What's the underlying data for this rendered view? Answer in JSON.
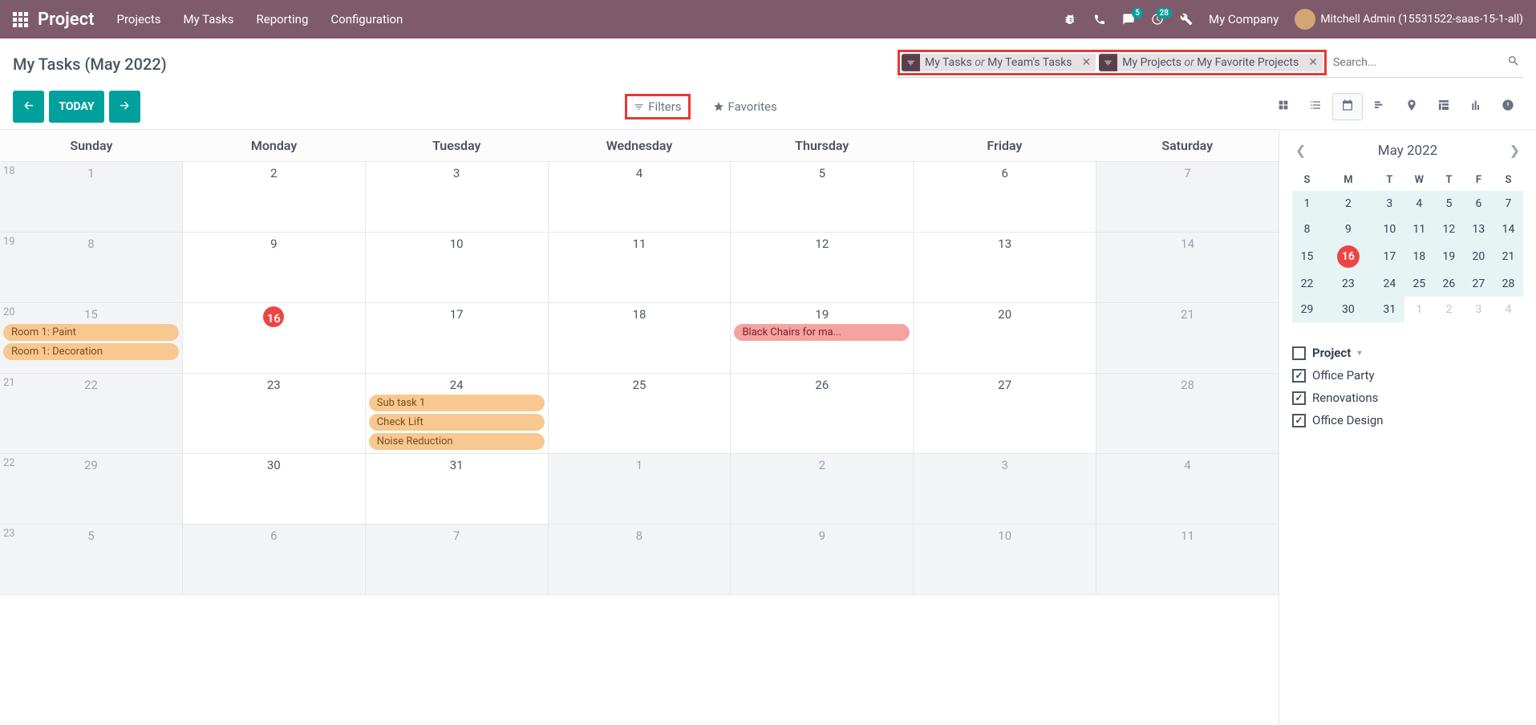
{
  "nav": {
    "brand": "Project",
    "links": [
      "Projects",
      "My Tasks",
      "Reporting",
      "Configuration"
    ],
    "messages_badge": "5",
    "activities_badge": "28",
    "company": "My Company",
    "user": "Mitchell Admin (15531522-saas-15-1-all)"
  },
  "cp": {
    "title": "My Tasks (May 2022)",
    "chip1_a": "My Tasks",
    "chip1_or": "or",
    "chip1_b": "My Team's Tasks",
    "chip2_a": "My Projects",
    "chip2_or": "or",
    "chip2_b": "My Favorite Projects",
    "search_placeholder": "Search...",
    "today": "TODAY",
    "filters": "Filters",
    "favorites": "Favorites"
  },
  "cal": {
    "days": [
      "Sunday",
      "Monday",
      "Tuesday",
      "Wednesday",
      "Thursday",
      "Friday",
      "Saturday"
    ],
    "weeks": [
      {
        "num": "18",
        "cells": [
          {
            "n": "1",
            "o": false
          },
          {
            "n": "2"
          },
          {
            "n": "3"
          },
          {
            "n": "4"
          },
          {
            "n": "5"
          },
          {
            "n": "6"
          },
          {
            "n": "7",
            "o": true
          }
        ]
      },
      {
        "num": "19",
        "cells": [
          {
            "n": "8",
            "o": false
          },
          {
            "n": "9"
          },
          {
            "n": "10"
          },
          {
            "n": "11"
          },
          {
            "n": "12"
          },
          {
            "n": "13"
          },
          {
            "n": "14",
            "o": true
          }
        ]
      },
      {
        "num": "20",
        "cells": [
          {
            "n": "15",
            "o": false,
            "ev": [
              {
                "t": "Room 1: Paint",
                "c": "orange"
              },
              {
                "t": "Room 1: Decoration",
                "c": "orange"
              }
            ]
          },
          {
            "n": "16",
            "today": true
          },
          {
            "n": "17"
          },
          {
            "n": "18"
          },
          {
            "n": "19",
            "ev": [
              {
                "t": "Black Chairs for ma...",
                "c": "pink"
              }
            ]
          },
          {
            "n": "20"
          },
          {
            "n": "21",
            "o": true
          }
        ]
      },
      {
        "num": "21",
        "cells": [
          {
            "n": "22",
            "o": false
          },
          {
            "n": "23"
          },
          {
            "n": "24",
            "ev": [
              {
                "t": "Sub task 1",
                "c": "orange"
              },
              {
                "t": "Check Lift",
                "c": "orange"
              },
              {
                "t": "Noise Reduction",
                "c": "orange"
              }
            ]
          },
          {
            "n": "25"
          },
          {
            "n": "26"
          },
          {
            "n": "27"
          },
          {
            "n": "28",
            "o": true
          }
        ]
      },
      {
        "num": "22",
        "cells": [
          {
            "n": "29",
            "o": false
          },
          {
            "n": "30"
          },
          {
            "n": "31"
          },
          {
            "n": "1",
            "o": true
          },
          {
            "n": "2",
            "o": true
          },
          {
            "n": "3",
            "o": true
          },
          {
            "n": "4",
            "o": true
          }
        ]
      },
      {
        "num": "23",
        "cells": [
          {
            "n": "5",
            "o": true
          },
          {
            "n": "6",
            "o": true
          },
          {
            "n": "7",
            "o": true
          },
          {
            "n": "8",
            "o": true
          },
          {
            "n": "9",
            "o": true
          },
          {
            "n": "10",
            "o": true
          },
          {
            "n": "11",
            "o": true
          }
        ]
      }
    ]
  },
  "mini": {
    "title": "May 2022",
    "dow": [
      "S",
      "M",
      "T",
      "W",
      "T",
      "F",
      "S"
    ],
    "rows": [
      [
        {
          "n": "1",
          "m": true
        },
        {
          "n": "2",
          "m": true
        },
        {
          "n": "3",
          "m": true
        },
        {
          "n": "4",
          "m": true
        },
        {
          "n": "5",
          "m": true
        },
        {
          "n": "6",
          "m": true
        },
        {
          "n": "7",
          "m": true
        }
      ],
      [
        {
          "n": "8",
          "m": true
        },
        {
          "n": "9",
          "m": true
        },
        {
          "n": "10",
          "m": true
        },
        {
          "n": "11",
          "m": true
        },
        {
          "n": "12",
          "m": true
        },
        {
          "n": "13",
          "m": true
        },
        {
          "n": "14",
          "m": true
        }
      ],
      [
        {
          "n": "15",
          "m": true
        },
        {
          "n": "16",
          "m": true,
          "today": true
        },
        {
          "n": "17",
          "m": true
        },
        {
          "n": "18",
          "m": true
        },
        {
          "n": "19",
          "m": true
        },
        {
          "n": "20",
          "m": true
        },
        {
          "n": "21",
          "m": true
        }
      ],
      [
        {
          "n": "22",
          "m": true
        },
        {
          "n": "23",
          "m": true
        },
        {
          "n": "24",
          "m": true
        },
        {
          "n": "25",
          "m": true
        },
        {
          "n": "26",
          "m": true
        },
        {
          "n": "27",
          "m": true
        },
        {
          "n": "28",
          "m": true
        }
      ],
      [
        {
          "n": "29",
          "m": true
        },
        {
          "n": "30",
          "m": true
        },
        {
          "n": "31",
          "m": true
        },
        {
          "n": "1"
        },
        {
          "n": "2"
        },
        {
          "n": "3"
        },
        {
          "n": "4"
        }
      ]
    ]
  },
  "filters_side": {
    "header": "Project",
    "items": [
      "Office Party",
      "Renovations",
      "Office Design"
    ]
  }
}
